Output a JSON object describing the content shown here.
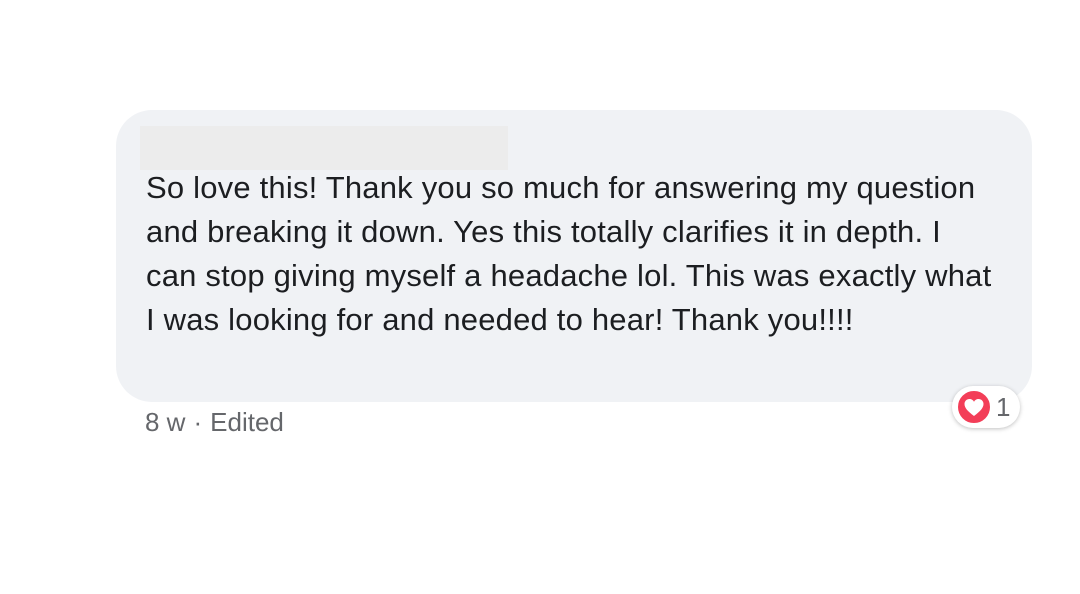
{
  "comment": {
    "text": "So love this! Thank you so much for answering my question and breaking it down. Yes this totally clarifies it in depth. I can stop giving myself a headache lol. This was exactly what I was looking for and needed to hear! Thank you!!!!",
    "timestamp": "8 w",
    "separator": "·",
    "edited_label": "Edited"
  },
  "reaction": {
    "icon": "heart-icon",
    "count": "1",
    "color": "#f33e58"
  },
  "colors": {
    "bubble_background": "#f0f2f5",
    "text": "#1c1e21",
    "meta_text": "#65676b"
  }
}
